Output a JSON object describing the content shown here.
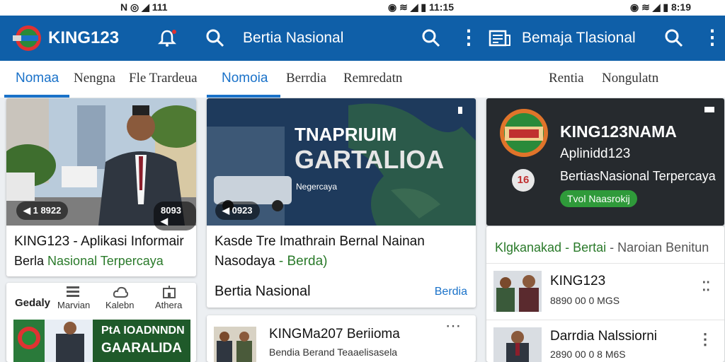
{
  "statusbar": {
    "left": "N ◎ ◢ 111",
    "center": "◉ ≋ ◢ ▮ 11:15",
    "right": "◉ ≋ ◢ ▮ 8:19"
  },
  "appbar": {
    "logo_text": "KING123",
    "search_title_1": "Bertia Nasional",
    "search_title_2": "Bemaja Tlasional"
  },
  "tabs": {
    "left": [
      "Nomaa",
      "Nengna",
      "Fle Trardeua"
    ],
    "middle": [
      "Nomoia",
      "Berrdia",
      "Remredatn"
    ],
    "right": [
      "Rentia",
      "Nongulatn"
    ]
  },
  "card_left": {
    "badge_left": "◀ 1 8922",
    "badge_right": "8093 ◀",
    "title": "KING123 - Aplikasi Informair",
    "subtitle_a": "Berla",
    "subtitle_b": "Nasional Terpercaya"
  },
  "mini_tabs": [
    "Gedaly",
    "Marvian",
    "Kalebn",
    "Athera"
  ],
  "promo": {
    "line1": "PtA IOADNNDN",
    "line2": "GAARALIDA"
  },
  "card_middle": {
    "overlay_title_1": "TNAPRIUIM",
    "overlay_title_2": "GARTALIOA",
    "overlay_sub": "Negercaya",
    "badge": "◀ 0923",
    "headline_1": "Kasde Tre Imathrain Bernal Nainan",
    "headline_2": "Nasodaya",
    "headline_tag": "- Berda)",
    "footer_title": "Bertia Nasional",
    "footer_link": "Berdia"
  },
  "card_middle_2": {
    "title": "KINGMa207 Beriioma",
    "subtitle": "Bendia Berand Teaaelisasela"
  },
  "card_right": {
    "brand": "KING123NAMA",
    "line1": "Aplinidd123",
    "line2": "BertiasNasional Terpercaya",
    "number_badge": "16",
    "green_button": "Tvol Naasrokij",
    "section_title_a": "Klgkanakad",
    "section_title_b": "- Bertai",
    "section_title_c": "- Naroian Benitun",
    "item1_title": "KING123",
    "item1_sub": "8890 00 0 MGS",
    "item2_title": "Darrdia Nalssiorni",
    "item2_sub": "2890 00 0 8 M6S"
  },
  "colors": {
    "appbar": "#0f5fa8",
    "accent": "#1a72c9",
    "green": "#2a7a2a"
  }
}
